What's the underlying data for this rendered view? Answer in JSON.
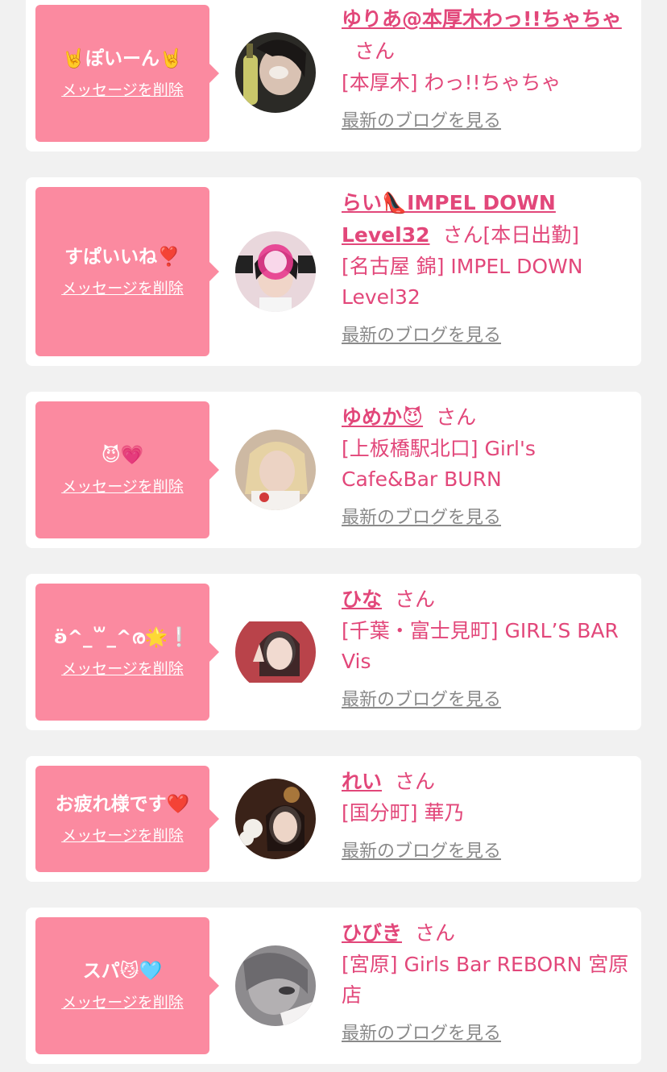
{
  "colors": {
    "accent": "#e2477a",
    "bubble": "#fb8aa0",
    "page_bg": "#f1f1f1",
    "card_bg": "#ffffff",
    "link_gray": "#8a8a8a"
  },
  "cards": [
    {
      "message": "🤘ぽいーん🤘",
      "delete_label": "メッセージを削除",
      "name": "ゆりあ@本厚木わっ!!ちゃちゃ",
      "honorific": "さん",
      "extra": "",
      "shop": "[本厚木] わっ!!ちゃちゃ",
      "blog_label": "最新のブログを見る"
    },
    {
      "message": "すぱいいね❣️",
      "delete_label": "メッセージを削除",
      "name": "らい👠IMPEL DOWN Level32",
      "honorific": "さん",
      "extra": "[本日出勤]",
      "shop": "[名古屋 錦] IMPEL DOWN Level32",
      "blog_label": "最新のブログを見る"
    },
    {
      "message": "😈💗",
      "delete_label": "メッセージを削除",
      "name": "ゆめか😈",
      "honorific": "さん",
      "extra": "",
      "shop": "[上板橋駅北口] Girl's Cafe&Bar BURN",
      "blog_label": "最新のブログを見る"
    },
    {
      "message": "ʚ̈^_꒳_^ര🌟❕",
      "delete_label": "メッセージを削除",
      "name": "ひな",
      "honorific": "さん",
      "extra": "",
      "shop": "[千葉・富士見町] GIRL’S BAR Vis",
      "blog_label": "最新のブログを見る"
    },
    {
      "message": "お疲れ様です❤️",
      "delete_label": "メッセージを削除",
      "name": "れい",
      "honorific": "さん",
      "extra": "",
      "shop": "[国分町] 華乃",
      "blog_label": "最新のブログを見る"
    },
    {
      "message": "スパ😼🩵",
      "delete_label": "メッセージを削除",
      "name": "ひびき",
      "honorific": "さん",
      "extra": "",
      "shop": "[宮原] Girls Bar REBORN 宮原店",
      "blog_label": "最新のブログを見る"
    }
  ]
}
